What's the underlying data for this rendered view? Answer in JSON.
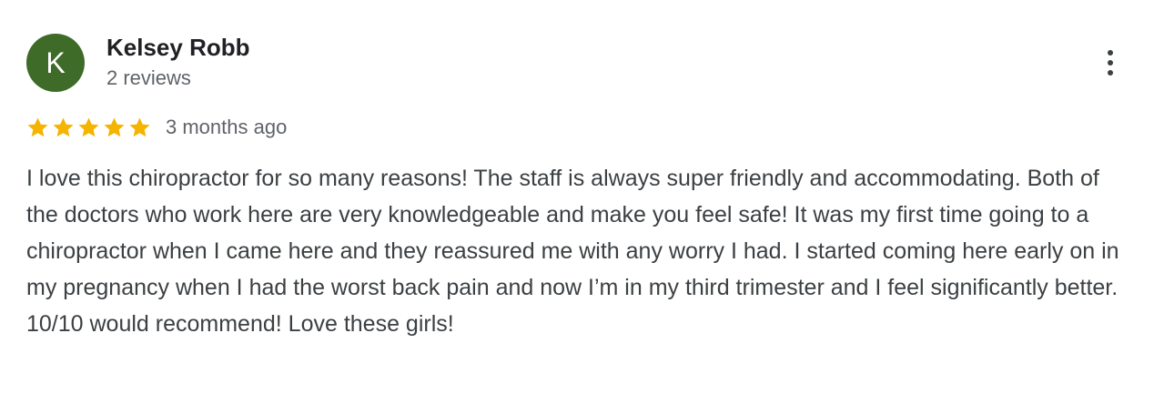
{
  "review": {
    "author": {
      "initial": "K",
      "name": "Kelsey Robb",
      "review_count": "2 reviews",
      "avatar_color": "#3e6b28"
    },
    "rating": {
      "value": 5,
      "max": 5,
      "star_color": "#f4b400"
    },
    "time_ago": "3 months ago",
    "text": "I love this chiropractor for so many reasons! The staff is always super friendly and accommodating. Both of the doctors who work here are very knowledgeable and make you feel safe! It was my first time going to a chiropractor when I came here and they reassured me with any worry I had. I started coming here early on in my pregnancy when I had the worst back pain and now I’m in my third trimester and I feel significantly better. 10/10 would recommend! Love these girls!",
    "more_options_icon": "more-vertical-icon"
  }
}
